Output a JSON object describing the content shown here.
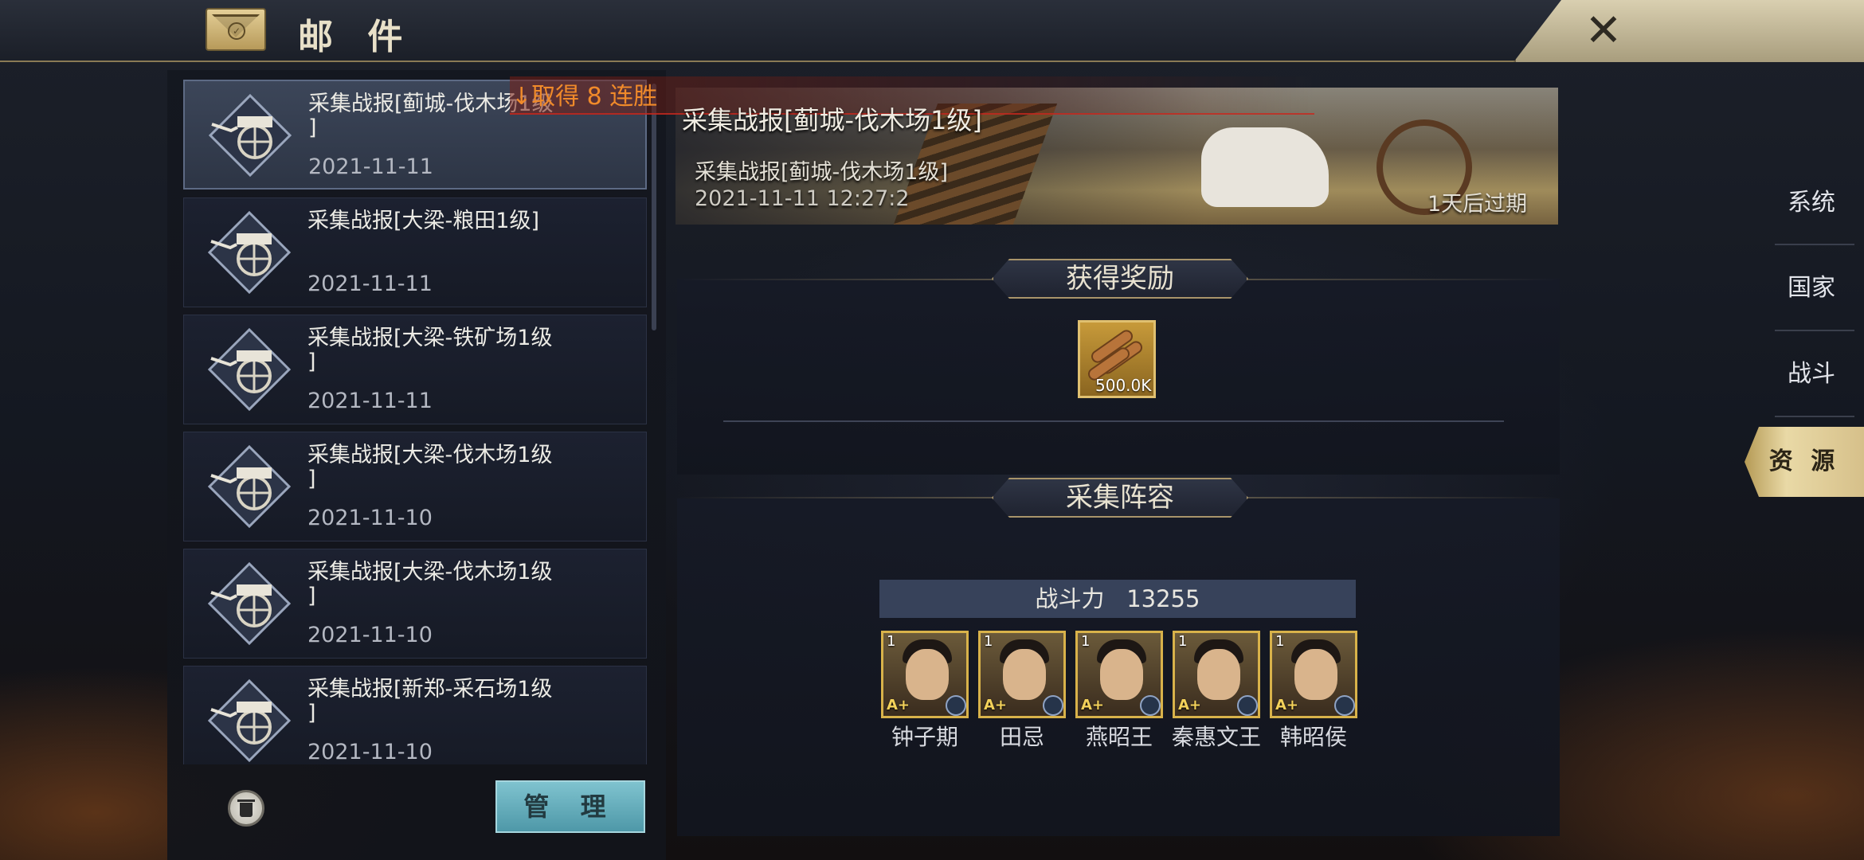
{
  "header": {
    "title": "邮 件",
    "close_label": "✕"
  },
  "notification": {
    "text": "↓取得 8 连胜"
  },
  "mail_list": [
    {
      "subject": "采集战报[蓟城-伐木场1级\n]",
      "date": "2021-11-11",
      "selected": true
    },
    {
      "subject": "采集战报[大梁-粮田1级]",
      "date": "2021-11-11",
      "selected": false
    },
    {
      "subject": "采集战报[大梁-铁矿场1级\n]",
      "date": "2021-11-11",
      "selected": false
    },
    {
      "subject": "采集战报[大梁-伐木场1级\n]",
      "date": "2021-11-10",
      "selected": false
    },
    {
      "subject": "采集战报[大梁-伐木场1级\n]",
      "date": "2021-11-10",
      "selected": false
    },
    {
      "subject": "采集战报[新郑-采石场1级\n]",
      "date": "2021-11-10",
      "selected": false
    }
  ],
  "list_footer": {
    "manage_label": "管 理"
  },
  "detail": {
    "title": "采集战报[蓟城-伐木场1级]",
    "subtitle": "采集战报[蓟城-伐木场1级]",
    "timestamp": "2021-11-11 12:27:2",
    "expire": "1天后过期",
    "reward_section_title": "获得奖励",
    "reward": {
      "item": "wood-icon",
      "quantity": "500.0K"
    },
    "lineup_section_title": "采集阵容",
    "power_label": "战斗力",
    "power_value": "13255",
    "heroes": [
      {
        "name": "钟子期",
        "level": "1",
        "grade": "A+"
      },
      {
        "name": "田忌",
        "level": "1",
        "grade": "A+"
      },
      {
        "name": "燕昭王",
        "level": "1",
        "grade": "A+"
      },
      {
        "name": "秦惠文王",
        "level": "1",
        "grade": "A+"
      },
      {
        "name": "韩昭侯",
        "level": "1",
        "grade": "A+"
      }
    ]
  },
  "side_tabs": [
    {
      "label": "系统",
      "active": false
    },
    {
      "label": "国家",
      "active": false
    },
    {
      "label": "战斗",
      "active": false
    },
    {
      "label": "资 源",
      "active": true
    }
  ],
  "colors": {
    "accent_gold": "#d8b24a",
    "manage_button": "#5aa7b6",
    "notification": "#f08a2a"
  }
}
